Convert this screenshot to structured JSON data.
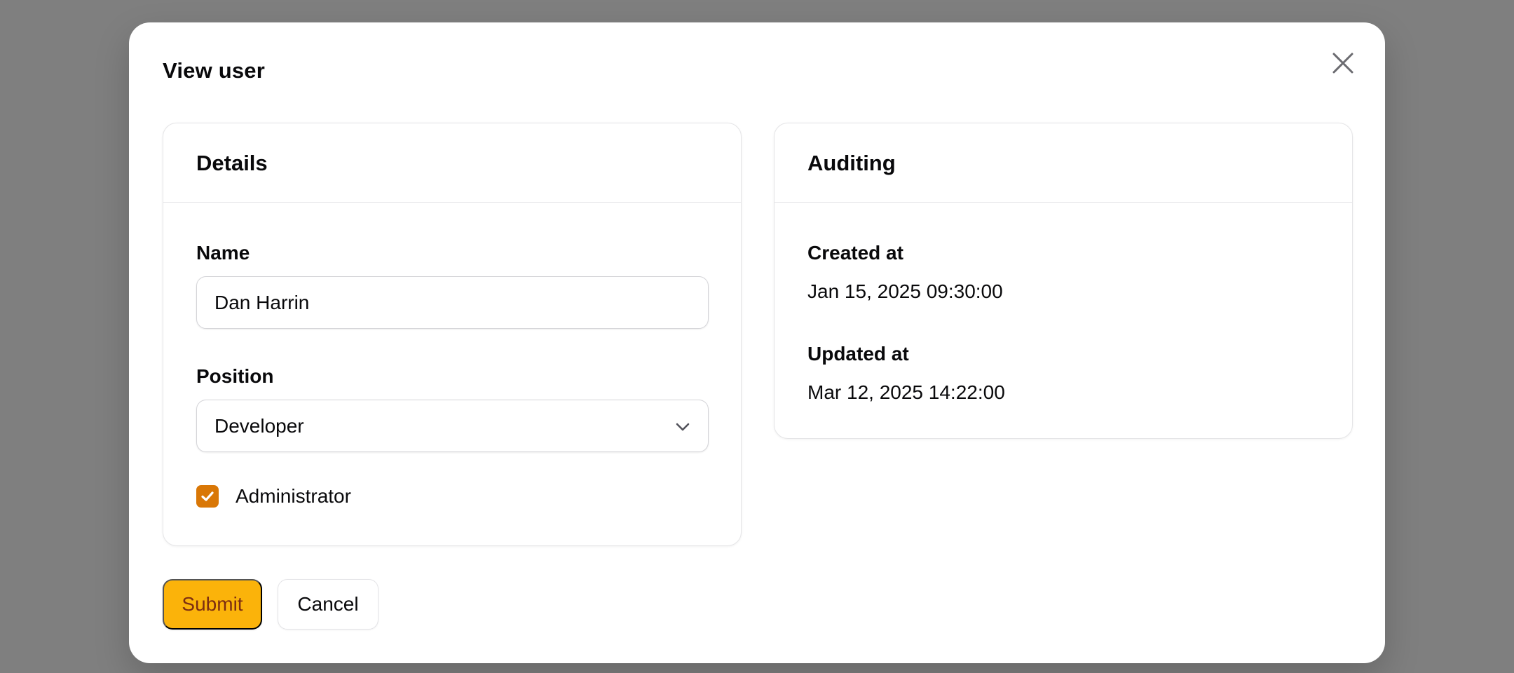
{
  "modal": {
    "title": "View user",
    "close_icon": "close-icon"
  },
  "details": {
    "title": "Details",
    "name_label": "Name",
    "name_value": "Dan Harrin",
    "position_label": "Position",
    "position_value": "Developer",
    "administrator_label": "Administrator",
    "administrator_checked": true
  },
  "auditing": {
    "title": "Auditing",
    "created_label": "Created at",
    "created_value": "Jan 15, 2025 09:30:00",
    "updated_label": "Updated at",
    "updated_value": "Mar 12, 2025 14:22:00"
  },
  "actions": {
    "submit_label": "Submit",
    "cancel_label": "Cancel"
  },
  "colors": {
    "accent": "#fbb30a",
    "checkbox": "#d97706",
    "backdrop": "#7f7f7f"
  }
}
